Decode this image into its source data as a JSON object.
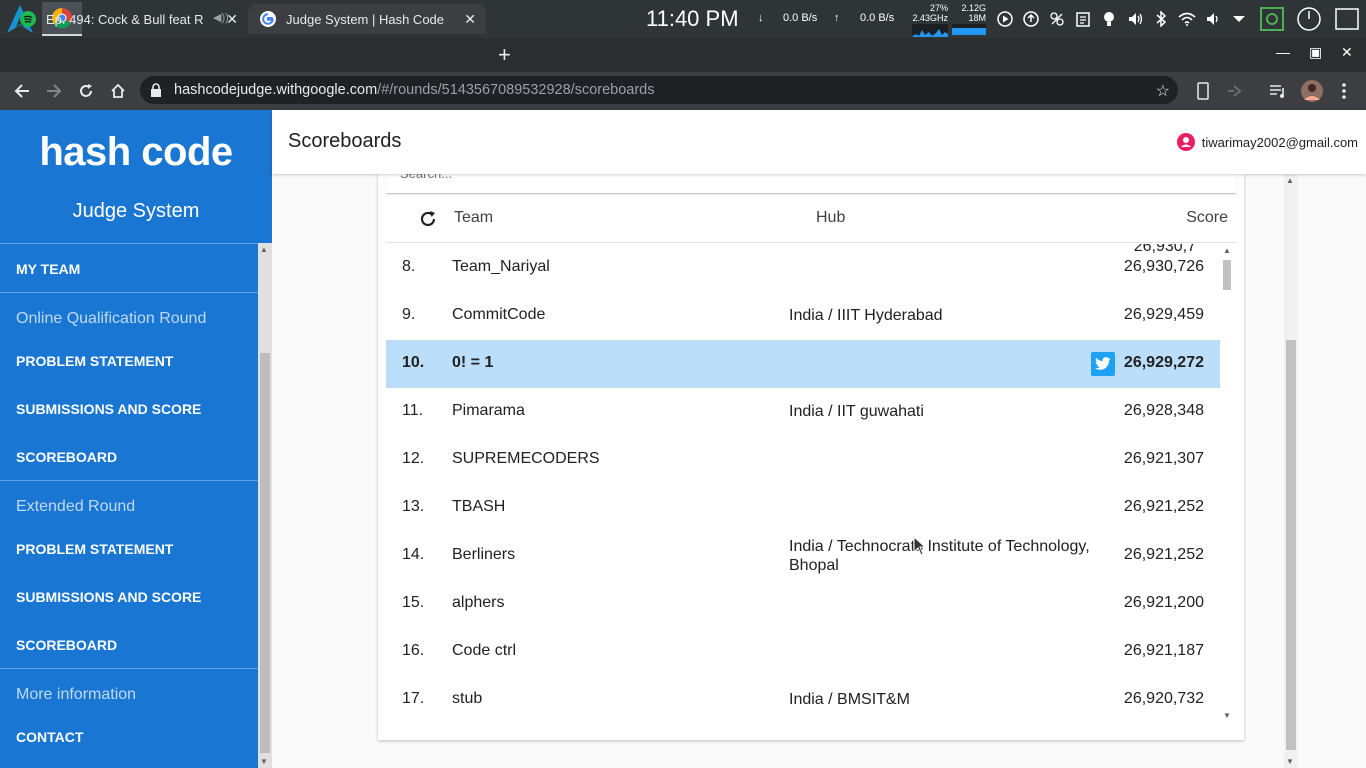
{
  "os": {
    "clock": "11:40 PM",
    "download_rate": "0.0 B/s",
    "upload_rate": "0.0 B/s",
    "cpu_percent": "27%",
    "cpu_freq": "2.43GHz",
    "mem_total": "2.12G",
    "mem_used": "18M"
  },
  "browser": {
    "tabs": [
      {
        "title": "Ep. 494: Cock & Bull feat R",
        "icon": "spotify-icon"
      },
      {
        "title": "Judge System | Hash Code",
        "icon": "google-icon"
      }
    ],
    "url_host": "hashcodejudge.withgoogle.com",
    "url_path": "/#/rounds/5143567089532928/scoreboards"
  },
  "sidebar": {
    "logo": "hash code",
    "subtitle": "Judge System",
    "my_team": "MY TEAM",
    "section_online": "Online Qualification Round",
    "online_items": [
      "PROBLEM STATEMENT",
      "SUBMISSIONS AND SCORE",
      "SCOREBOARD"
    ],
    "section_extended": "Extended Round",
    "extended_items": [
      "PROBLEM STATEMENT",
      "SUBMISSIONS AND SCORE",
      "SCOREBOARD"
    ],
    "section_more": "More information",
    "contact": "CONTACT"
  },
  "header": {
    "title": "Scoreboards",
    "user_email": "tiwarimay2002@gmail.com"
  },
  "scoreboard": {
    "search_placeholder": "Search...",
    "col_team": "Team",
    "col_hub": "Hub",
    "col_score": "Score",
    "partial_score": "26,930,7",
    "rows": [
      {
        "rank": "8.",
        "team": "Team_Nariyal",
        "hub": "",
        "score": "26,930,726"
      },
      {
        "rank": "9.",
        "team": "CommitCode",
        "hub": "India / IIIT Hyderabad",
        "score": "26,929,459"
      },
      {
        "rank": "10.",
        "team": "0! = 1",
        "hub": "",
        "score": "26,929,272"
      },
      {
        "rank": "11.",
        "team": "Pimarama",
        "hub": "India / IIT guwahati",
        "score": "26,928,348"
      },
      {
        "rank": "12.",
        "team": "SUPREMECODERS",
        "hub": "",
        "score": "26,921,307"
      },
      {
        "rank": "13.",
        "team": "TBASH",
        "hub": "",
        "score": "26,921,252"
      },
      {
        "rank": "14.",
        "team": "Berliners",
        "hub": "India / Technocrats Institute of Technology, Bhopal",
        "score": "26,921,252"
      },
      {
        "rank": "15.",
        "team": "alphers",
        "hub": "",
        "score": "26,921,200"
      },
      {
        "rank": "16.",
        "team": "Code ctrl",
        "hub": "",
        "score": "26,921,187"
      },
      {
        "rank": "17.",
        "team": "stub",
        "hub": "India / BMSIT&M",
        "score": "26,920,732"
      }
    ]
  },
  "colors": {
    "sidebar": "#1976d2",
    "highlight_row": "#bbdefb",
    "twitter": "#1da1f2"
  }
}
